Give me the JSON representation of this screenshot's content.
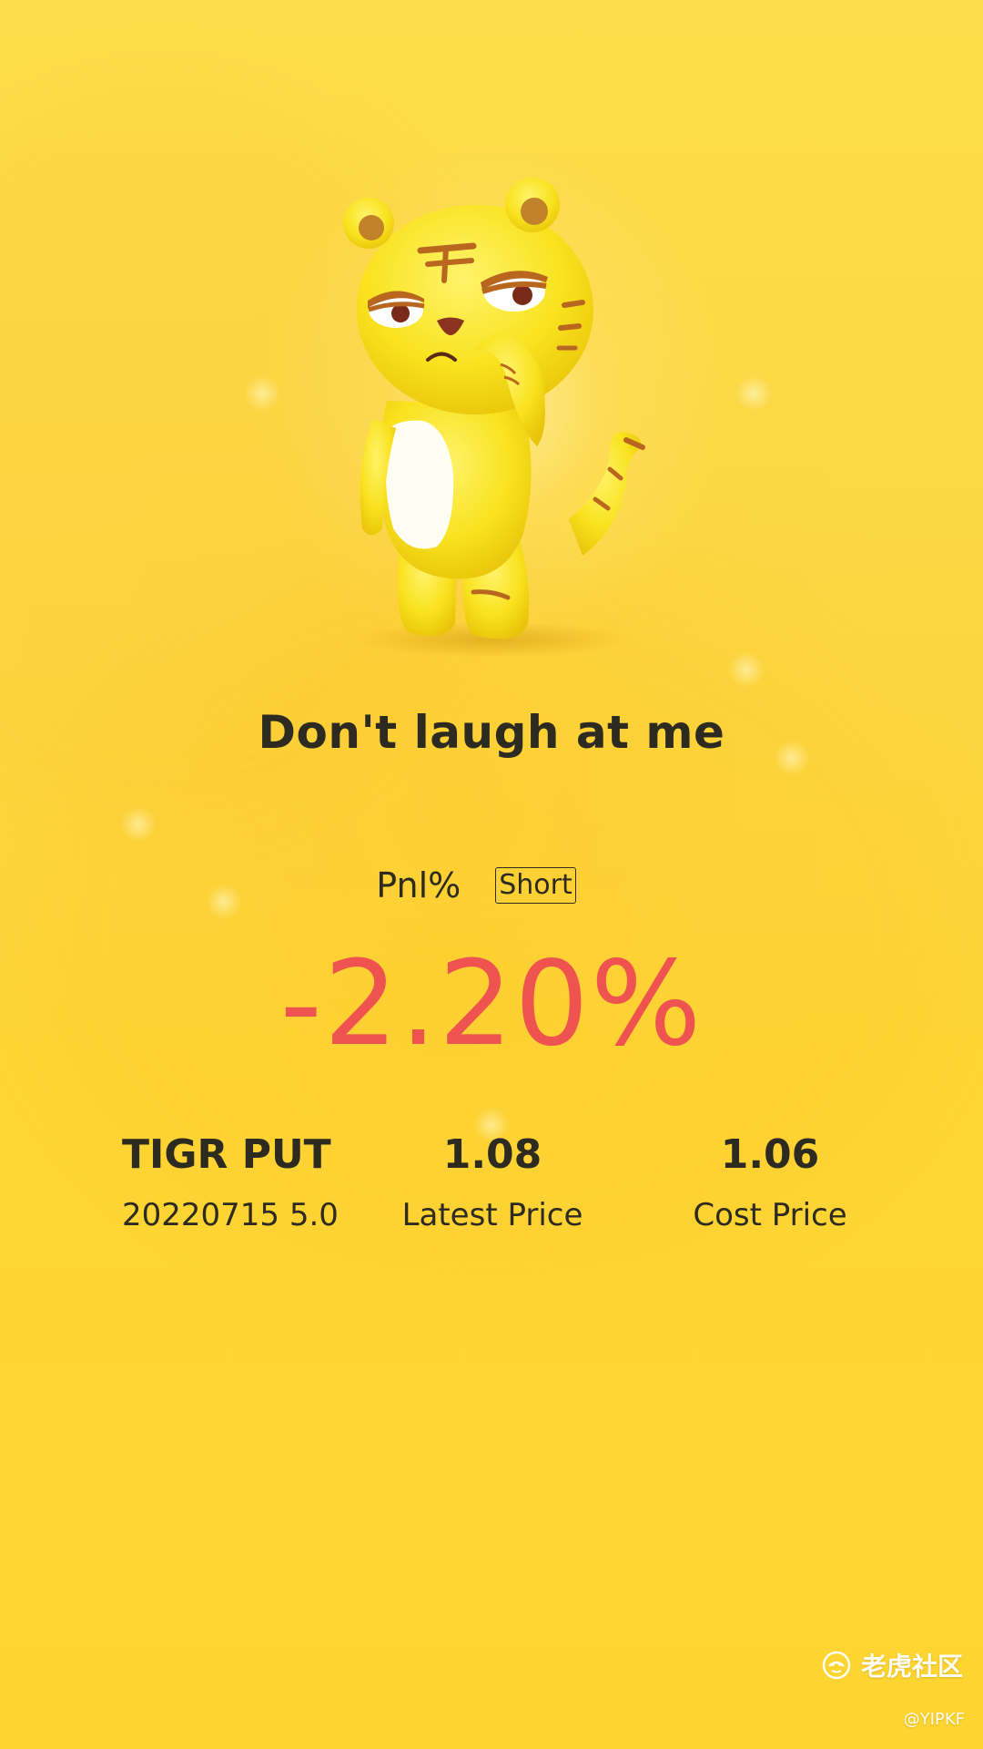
{
  "card": {
    "headline": "Don't laugh at me",
    "pnl_label": "Pnl%",
    "side_badge": "Short",
    "pnl_value": "-2.20%",
    "accent_negative": "#ef5350",
    "background": "#fdd535",
    "mascot": "grumpy-tiger-mascot-icon"
  },
  "stats": {
    "symbol": "TIGR PUT",
    "contract": "20220715 5.0",
    "latest_price": "1.08",
    "latest_price_label": "Latest Price",
    "cost_price": "1.06",
    "cost_price_label": "Cost Price"
  },
  "watermark": {
    "brand": "老虎社区",
    "handle": "@YIPKF",
    "logo": "tiger-community-logo-icon"
  }
}
